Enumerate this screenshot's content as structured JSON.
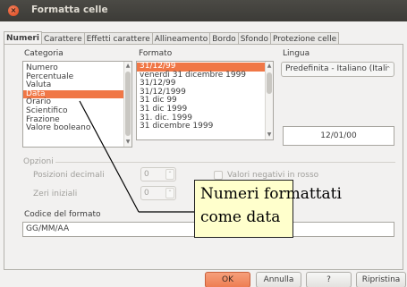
{
  "window": {
    "title": "Formatta celle",
    "close_glyph": "×"
  },
  "tabs": [
    {
      "label": "Numeri",
      "active": true
    },
    {
      "label": "Carattere"
    },
    {
      "label": "Effetti carattere"
    },
    {
      "label": "Allineamento"
    },
    {
      "label": "Bordo"
    },
    {
      "label": "Sfondo"
    },
    {
      "label": "Protezione celle"
    }
  ],
  "category": {
    "label": "Categoria",
    "items": [
      "Numero",
      "Percentuale",
      "Valuta",
      "Data",
      "Orario",
      "Scientifico",
      "Frazione",
      "Valore booleano"
    ],
    "selected": "Data"
  },
  "format": {
    "label": "Formato",
    "items": [
      "31/12/99",
      "venerdì 31 dicembre 1999",
      "31/12/99",
      "31/12/1999",
      "31 dic 99",
      "31 dic 1999",
      "31. dic. 1999",
      "31 dicembre 1999"
    ],
    "selected": "31/12/99"
  },
  "language": {
    "label": "Lingua",
    "value": "Predefinita - Italiano (Itali",
    "arrow": "⌃"
  },
  "preview": {
    "value": "12/01/00"
  },
  "options": {
    "label": "Opzioni",
    "decimal_places": {
      "label": "Posizioni decimali",
      "value": "0"
    },
    "leading_zeros": {
      "label": "Zeri iniziali",
      "value": "0"
    },
    "negative_red": {
      "label": "Valori negativi in rosso"
    }
  },
  "format_code": {
    "label": "Codice del formato",
    "value": "GG/MM/AA"
  },
  "buttons": {
    "ok": "OK",
    "cancel": "Annulla",
    "help": "?",
    "reset": "Ripristina"
  },
  "annotation": {
    "line1": "Numeri formattati",
    "line2": "come data"
  },
  "colors": {
    "accent": "#f07746",
    "titlebar": "#3c3b37",
    "callout_bg": "#ffffcc"
  },
  "icons": {
    "close": "close-icon",
    "spin_up": "up-arrow-icon",
    "spin_down": "down-arrow-icon"
  }
}
